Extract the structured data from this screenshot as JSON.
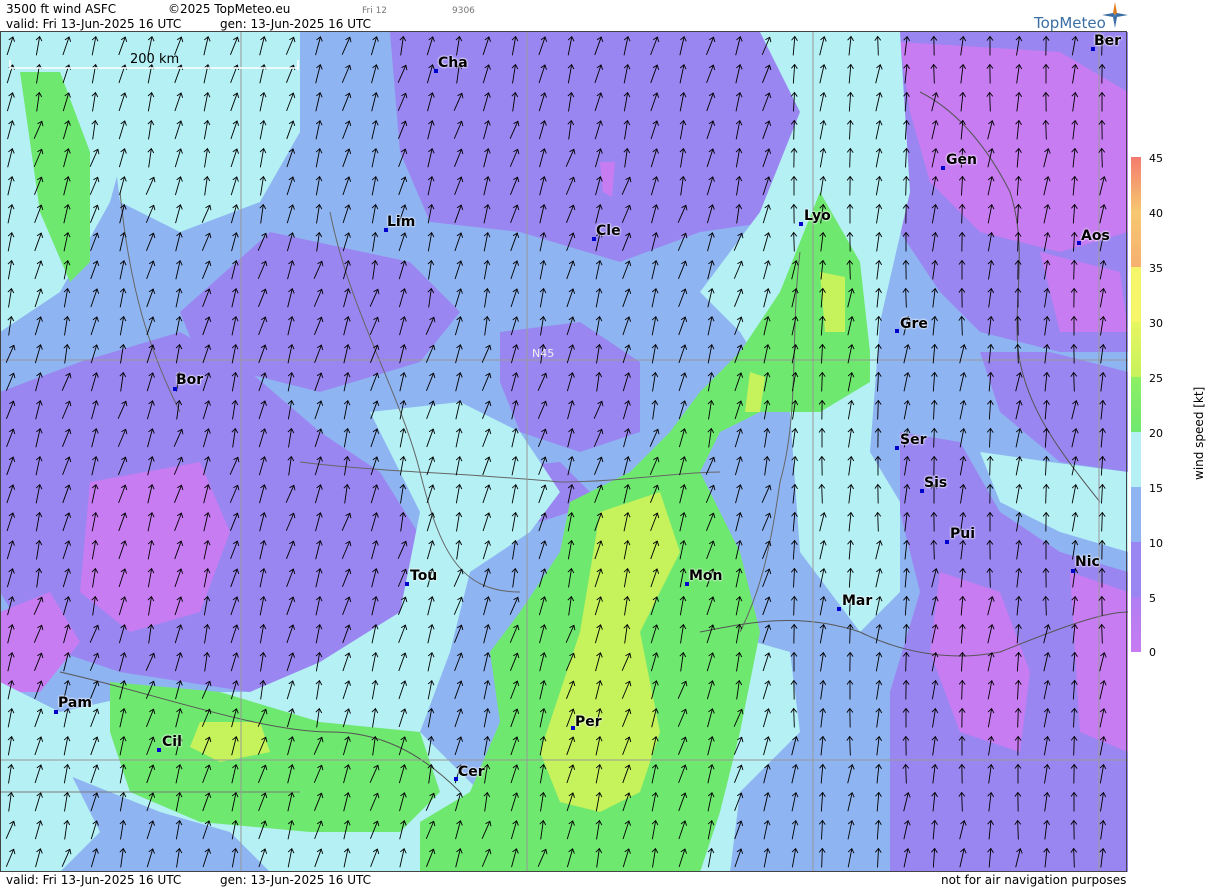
{
  "header": {
    "product": "3500 ft wind ASFC",
    "copyright": "©2025 TopMeteo.eu",
    "day_tag": "Fri 12",
    "code": "9306",
    "valid": "valid:  Fri  13-Jun-2025  16 UTC",
    "generated": "gen: 13-Jun-2025 16 UTC",
    "brand": "TopMeteo"
  },
  "map": {
    "scale_label": "200 km",
    "latitude_label": "N45",
    "cities": [
      {
        "name": "Cha"
      },
      {
        "name": "Ber"
      },
      {
        "name": "Gen"
      },
      {
        "name": "Lim"
      },
      {
        "name": "Cle"
      },
      {
        "name": "Lyo"
      },
      {
        "name": "Aos"
      },
      {
        "name": "Gre"
      },
      {
        "name": "Bor"
      },
      {
        "name": "Ser"
      },
      {
        "name": "Sis"
      },
      {
        "name": "Pui"
      },
      {
        "name": "Nic"
      },
      {
        "name": "Tou"
      },
      {
        "name": "Mon"
      },
      {
        "name": "Mar"
      },
      {
        "name": "Pam"
      },
      {
        "name": "Per"
      },
      {
        "name": "Cil"
      },
      {
        "name": "Cer"
      }
    ],
    "wind_direction": "from south / south-southwest",
    "colors": {
      "0_5": "#c77cf2",
      "5_10": "#9a86f0",
      "10_15": "#8fb4f2",
      "15_20": "#b4f0f4",
      "20_25": "#6fe86f",
      "25_30": "#c6f25c",
      "30_35": "#f5f56a",
      "35_40": "#f6c870",
      "40_45": "#f47b6e"
    }
  },
  "legend": {
    "title": "wind speed [kt]",
    "ticks": [
      "45",
      "40",
      "35",
      "30",
      "25",
      "20",
      "15",
      "10",
      "5",
      "0"
    ]
  },
  "footer": {
    "valid": "valid:  Fri  13-Jun-2025  16 UTC",
    "generated": "gen: 13-Jun-2025 16 UTC",
    "disclaimer": "not for air navigation purposes"
  }
}
